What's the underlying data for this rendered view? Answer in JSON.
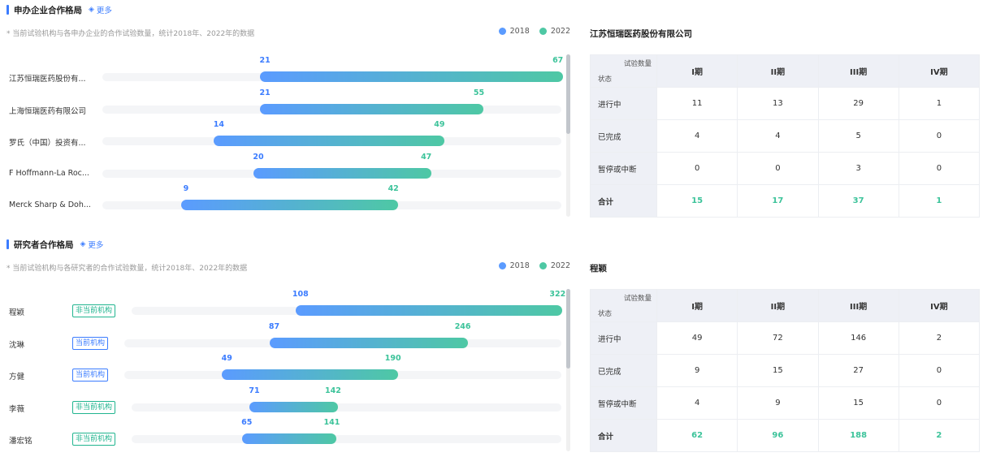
{
  "sections": [
    {
      "title": "申办企业合作格局",
      "more_label": "更多",
      "note": "* 当前试验机构与各申办企业的合作试验数量，统计2018年、2022年的数据",
      "legend": [
        {
          "label": "2018",
          "color": "#5b9bff"
        },
        {
          "label": "2022",
          "color": "#4ec8a4"
        }
      ],
      "rows": [
        {
          "label": "江苏恒瑞医药股份有...",
          "v2018": 21,
          "v2022": 67
        },
        {
          "label": "上海恒瑞医药有限公司",
          "v2018": 21,
          "v2022": 55
        },
        {
          "label": "罗氏（中国）投资有...",
          "v2018": 14,
          "v2022": 49
        },
        {
          "label": "F Hoffmann-La Roc...",
          "v2018": 20,
          "v2022": 47
        },
        {
          "label": "Merck Sharp & Doh...",
          "v2018": 9,
          "v2022": 42
        }
      ],
      "table": {
        "title": "江苏恒瑞医药股份有限公司",
        "corner_top": "试验数量",
        "corner_bottom": "状态",
        "columns": [
          "I期",
          "II期",
          "III期",
          "IV期"
        ],
        "rows": [
          {
            "label": "进行中",
            "values": [
              "11",
              "13",
              "29",
              "1"
            ]
          },
          {
            "label": "已完成",
            "values": [
              "4",
              "4",
              "5",
              "0"
            ]
          },
          {
            "label": "暂停或中断",
            "values": [
              "0",
              "0",
              "3",
              "0"
            ]
          }
        ],
        "total": {
          "label": "合计",
          "values": [
            "15",
            "17",
            "37",
            "1"
          ]
        }
      }
    },
    {
      "title": "研究者合作格局",
      "more_label": "更多",
      "note": "* 当前试验机构与各研究者的合作试验数量，统计2018年、2022年的数据",
      "legend": [
        {
          "label": "2018",
          "color": "#5b9bff"
        },
        {
          "label": "2022",
          "color": "#4ec8a4"
        }
      ],
      "rows": [
        {
          "label": "程颖",
          "tag": "非当前机构",
          "tag_type": "green",
          "v2018": 108,
          "v2022": 322
        },
        {
          "label": "沈琳",
          "tag": "当前机构",
          "tag_type": "blue",
          "v2018": 87,
          "v2022": 246
        },
        {
          "label": "方健",
          "tag": "当前机构",
          "tag_type": "blue",
          "v2018": 49,
          "v2022": 190
        },
        {
          "label": "李薇",
          "tag": "非当前机构",
          "tag_type": "green",
          "v2018": 71,
          "v2022": 142
        },
        {
          "label": "潘宏铭",
          "tag": "非当前机构",
          "tag_type": "green",
          "v2018": 65,
          "v2022": 141
        }
      ],
      "table": {
        "title": "程颖",
        "corner_top": "试验数量",
        "corner_bottom": "状态",
        "columns": [
          "I期",
          "II期",
          "III期",
          "IV期"
        ],
        "rows": [
          {
            "label": "进行中",
            "values": [
              "49",
              "72",
              "146",
              "2"
            ]
          },
          {
            "label": "已完成",
            "values": [
              "9",
              "15",
              "27",
              "0"
            ]
          },
          {
            "label": "暂停或中断",
            "values": [
              "4",
              "9",
              "15",
              "0"
            ]
          }
        ],
        "total": {
          "label": "合计",
          "values": [
            "62",
            "96",
            "188",
            "2"
          ]
        }
      }
    }
  ]
}
